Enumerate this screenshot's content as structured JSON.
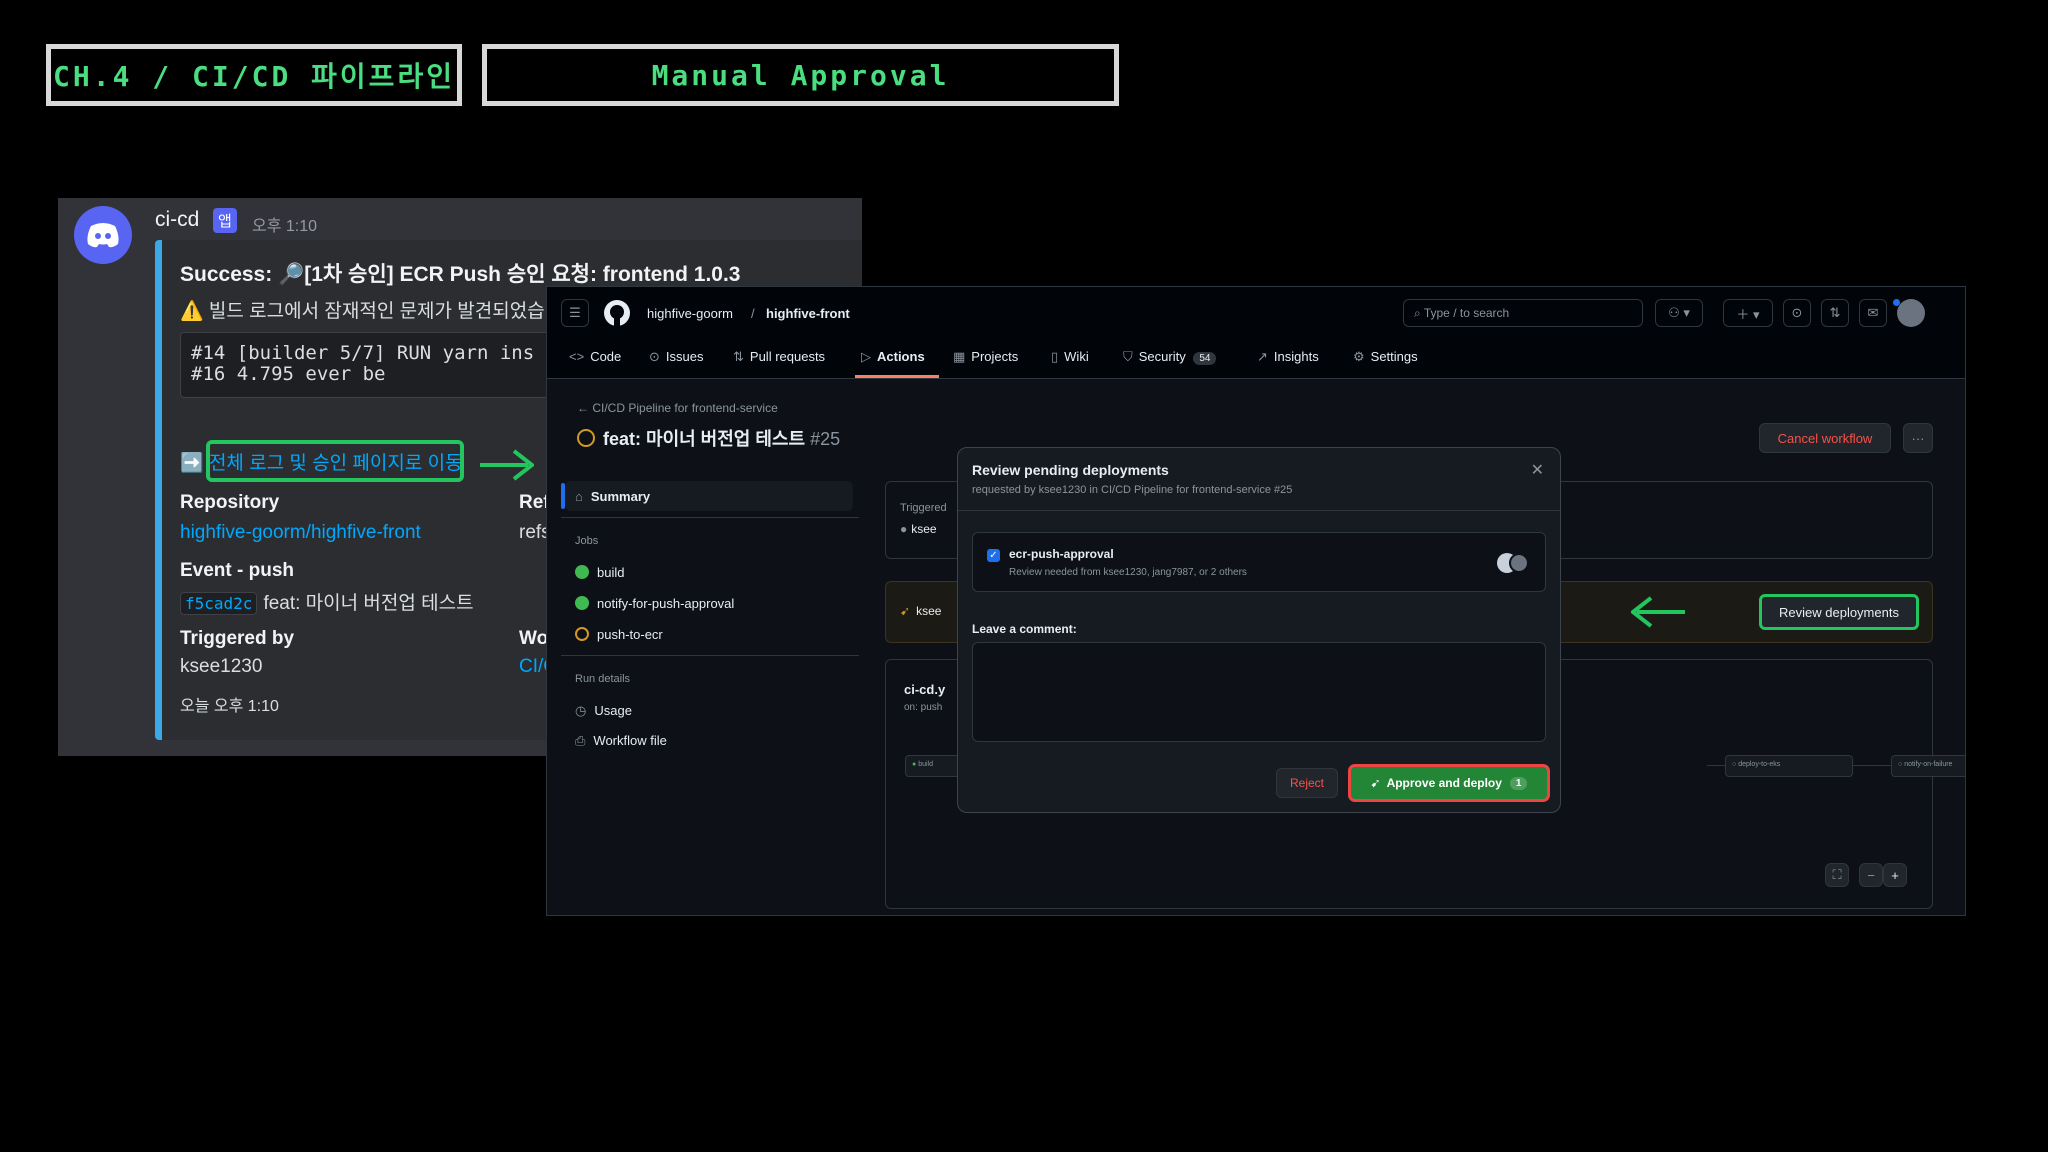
{
  "slide": {
    "chapter": "CH.4 / CI/CD 파이프라인",
    "topic": "Manual Approval"
  },
  "discord": {
    "bot_name": "ci-cd",
    "app_badge": "앱",
    "time": "오후 1:10",
    "title": "Success: 🔎[1차 승인] ECR Push 승인 요청: frontend 1.0.3",
    "warning": "⚠️ 빌드 로그에서 잠재적인 문제가 발견되었습니",
    "code_lines": "#14 [builder 5/7] RUN yarn ins\n#16 4.795 ever be",
    "link_icon": "➡️",
    "link_text": "전체 로그 및 승인 페이지로 이동",
    "repo_label": "Repository",
    "repo_value": "highfive-goorm/highfive-front",
    "ref_label": "Ref",
    "ref_value": "refs",
    "event_label": "Event - push",
    "commit_hash": "f5cad2c",
    "commit_msg": "feat: 마이너 버전업 테스트",
    "triggered_label": "Triggered by",
    "triggered_value": "ksee1230",
    "workflow_label": "Wor",
    "workflow_value": "CI/C",
    "footer_time": "오늘 오후 1:10"
  },
  "github": {
    "owner": "highfive-goorm",
    "repo": "highfive-front",
    "search_placeholder": "Type / to search",
    "tabs": [
      {
        "label": "Code"
      },
      {
        "label": "Issues"
      },
      {
        "label": "Pull requests"
      },
      {
        "label": "Actions"
      },
      {
        "label": "Projects"
      },
      {
        "label": "Wiki"
      },
      {
        "label": "Security",
        "count": "54"
      },
      {
        "label": "Insights"
      },
      {
        "label": "Settings"
      }
    ],
    "breadcrumb": "CI/CD Pipeline for frontend-service",
    "run_title": "feat: 마이너 버전업 테스트",
    "run_number": "#25",
    "cancel_label": "Cancel workflow",
    "more_label": "···",
    "summary_label": "Summary",
    "jobs_heading": "Jobs",
    "jobs": [
      "build",
      "notify-for-push-approval",
      "push-to-ecr"
    ],
    "run_details_heading": "Run details",
    "usage_label": "Usage",
    "workflow_file_label": "Workflow file",
    "triggered_label": "Triggered",
    "triggered_user": "ksee",
    "pending_user": "ksee",
    "review_button": "Review deployments",
    "workflow_name": "ci-cd.y",
    "workflow_event": "on: push",
    "graph_nodes": [
      "build",
      "deploy-to-eks",
      "notify-on-failure"
    ],
    "modal": {
      "title": "Review pending deployments",
      "subtitle": "requested by ksee1230 in CI/CD Pipeline for frontend-service #25",
      "env_name": "ecr-push-approval",
      "env_sub": "Review needed from ksee1230, jang7987, or 2 others",
      "comment_label": "Leave a comment:",
      "reject": "Reject",
      "approve": "Approve and deploy",
      "approve_count": "1"
    }
  },
  "colors": {
    "accent_green": "#4ade80",
    "highlight": "#22c55e",
    "discord_link": "#00a8fc",
    "gh_green": "#238636",
    "gh_red": "#f85149"
  }
}
